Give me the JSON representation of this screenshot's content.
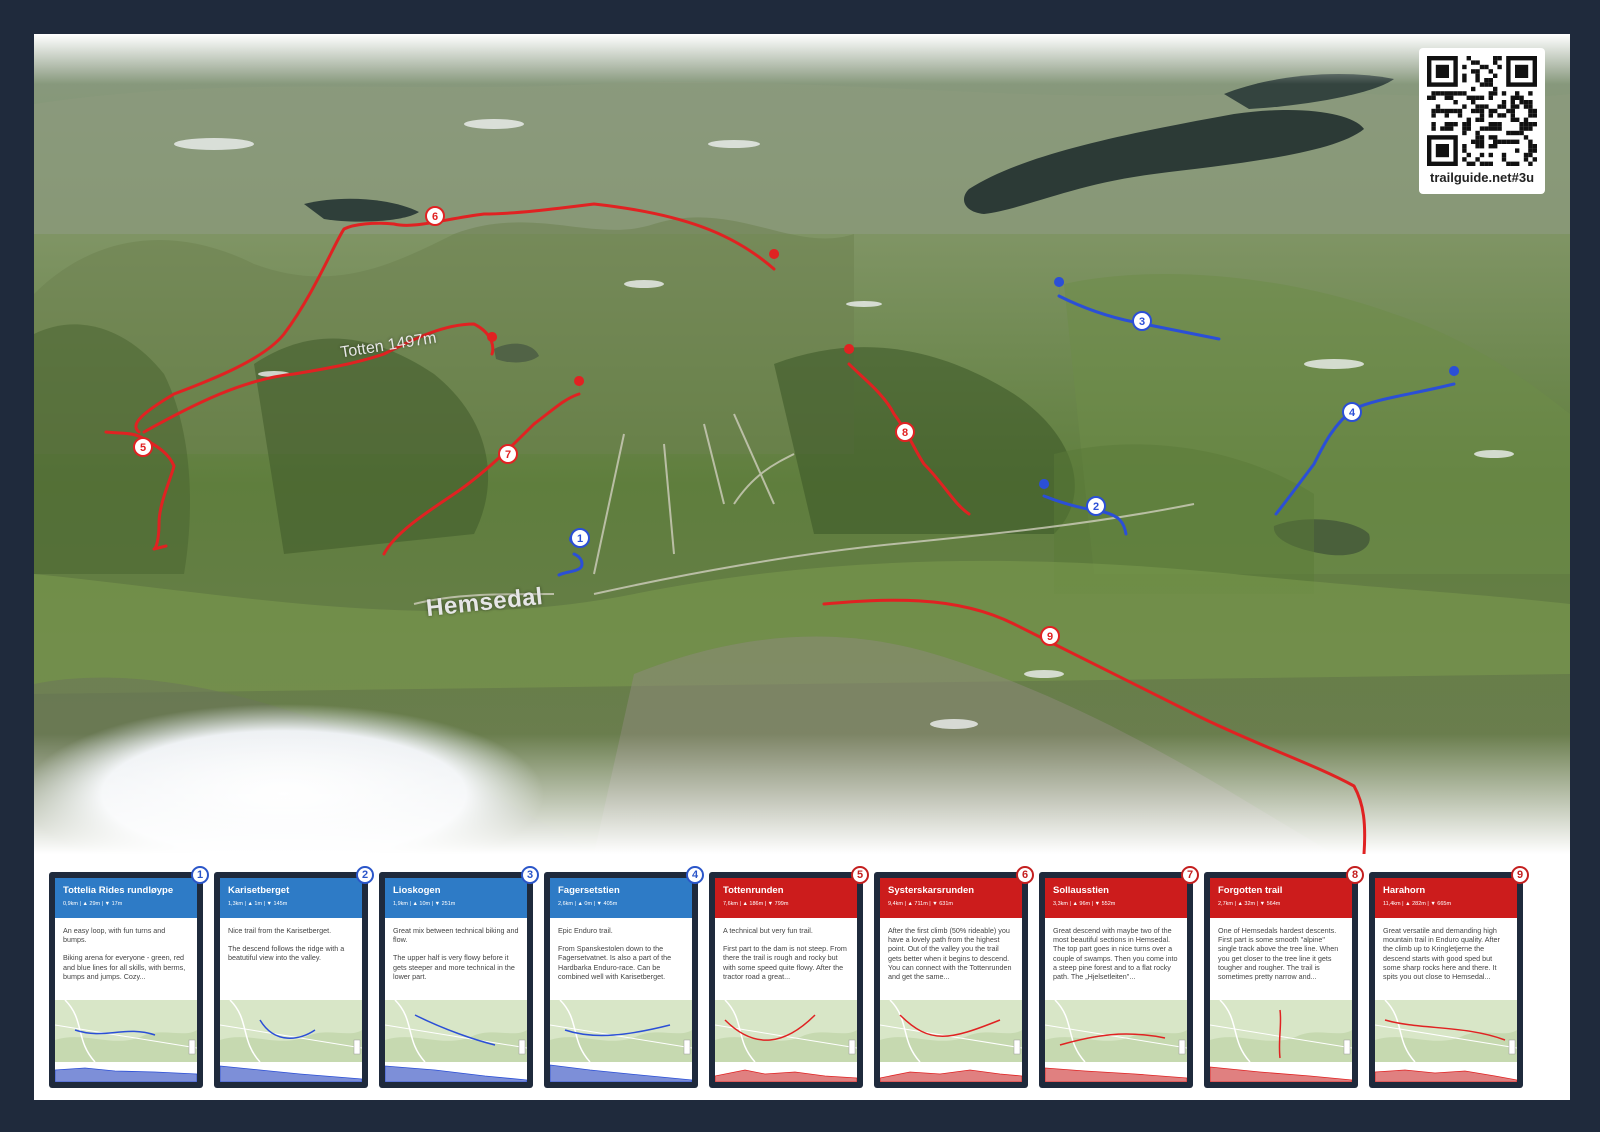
{
  "map": {
    "town_label": "Hemsedal",
    "peak_label": "Totten 1497m",
    "qr_url": "trailguide.net#3u",
    "colors": {
      "blue_trail": "#2b4fd6",
      "red_trail": "#e02222",
      "frame": "#1f2a3c"
    },
    "markers": [
      {
        "num": "1",
        "color": "blue"
      },
      {
        "num": "2",
        "color": "blue"
      },
      {
        "num": "3",
        "color": "blue"
      },
      {
        "num": "4",
        "color": "blue"
      },
      {
        "num": "5",
        "color": "red"
      },
      {
        "num": "6",
        "color": "red"
      },
      {
        "num": "7",
        "color": "red"
      },
      {
        "num": "8",
        "color": "red"
      },
      {
        "num": "9",
        "color": "red"
      }
    ]
  },
  "trails": [
    {
      "num": "1",
      "color": "blue",
      "title": "Tottelia Rides rundløype",
      "stats": "0,9km | ▲ 29m | ▼ 17m",
      "desc": [
        "An easy loop, with fun turns and bumps.",
        "Biking arena for everyone - green, red and blue lines for all skills, with berms, bumps and jumps. Cozy..."
      ]
    },
    {
      "num": "2",
      "color": "blue",
      "title": "Karisetberget",
      "stats": "1,3km | ▲ 1m | ▼ 145m",
      "desc": [
        "Nice trail from the Karisetberget.",
        "The descend follows the ridge with a beatutiful view into the valley."
      ]
    },
    {
      "num": "3",
      "color": "blue",
      "title": "Lioskogen",
      "stats": "1,9km | ▲ 10m | ▼ 251m",
      "desc": [
        "Great mix between technical biking and flow.",
        "The upper half is very flowy before it gets steeper and more technical in the lower part."
      ]
    },
    {
      "num": "4",
      "color": "blue",
      "title": "Fagersetstien",
      "stats": "2,6km | ▲ 0m | ▼ 405m",
      "desc": [
        "Epic Enduro trail.",
        "From Spanskestolen down to the Fagersetvatnet. Is also a part of the Hardbarka Enduro-race. Can be combined well with Karisetberget."
      ]
    },
    {
      "num": "5",
      "color": "red",
      "title": "Tottenrunden",
      "stats": "7,6km | ▲ 186m | ▼ 799m",
      "desc": [
        "A technical but very fun trail.",
        "First part to the dam is not steep. From there the trail is rough and rocky but with some speed quite flowy. After the tractor road a great..."
      ]
    },
    {
      "num": "6",
      "color": "red",
      "title": "Systerskarsrunden",
      "stats": "9,4km | ▲ 711m | ▼ 631m",
      "desc": [
        "After the first climb (50% rideable) you have a lovely path from the highest point. Out of the valley you the trail gets better when it begins to descend. You can connect with the Tottenrunden and get the same..."
      ]
    },
    {
      "num": "7",
      "color": "red",
      "title": "Sollausstien",
      "stats": "3,3km | ▲ 96m | ▼ 552m",
      "desc": [
        "Great descend with maybe two of the most beautiful sections in Hemsedal. The top part goes in nice turns over a couple of swamps. Then you come into a steep pine forest and to a flat rocky path. The „Hjelsetleiten\"..."
      ]
    },
    {
      "num": "8",
      "color": "red",
      "title": "Forgotten trail",
      "stats": "2,7km | ▲ 32m | ▼ 564m",
      "desc": [
        "One of Hemsedals hardest descents. First part is some smooth \"alpine\" single track above the tree line. When you get closer to the tree line it gets tougher and rougher. The trail is sometimes pretty narrow and..."
      ]
    },
    {
      "num": "9",
      "color": "red",
      "title": "Harahorn",
      "stats": "11,4km | ▲ 282m | ▼ 665m",
      "desc": [
        "Great versatile and demanding high mountain trail in Enduro quality. After the climb up to Kringletjerne the descend starts with good sped but some sharp rocks here and there. It spits you out close to Hemsedal..."
      ]
    }
  ]
}
